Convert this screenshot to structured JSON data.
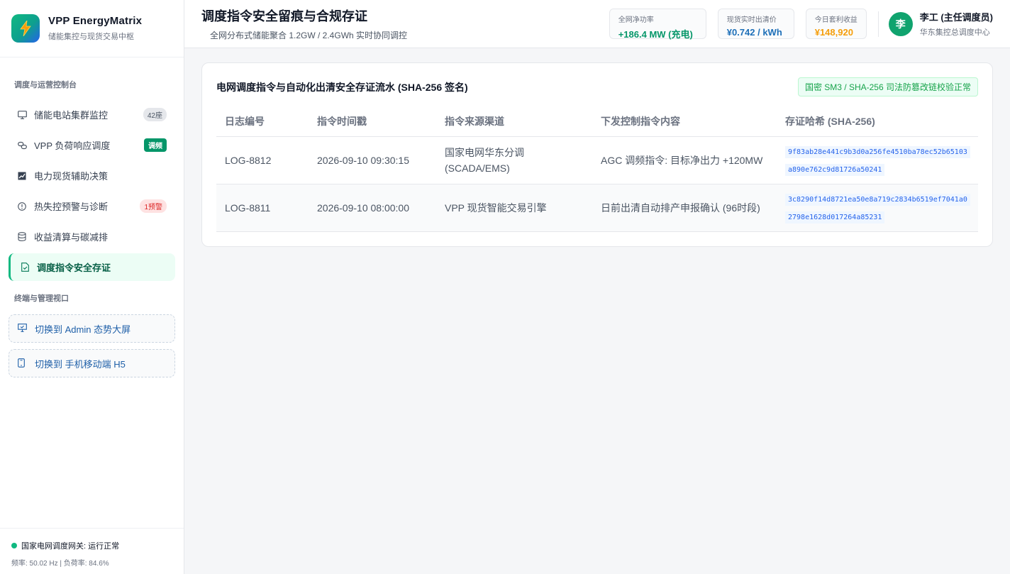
{
  "brand": {
    "title": "VPP EnergyMatrix",
    "subtitle": "储能集控与现货交易中枢"
  },
  "sidebar": {
    "section1_title": "调度与运营控制台",
    "items": [
      {
        "label": "储能电站集群监控",
        "icon": "monitor-icon",
        "badge": "42座"
      },
      {
        "label": "VPP 负荷响应调度",
        "icon": "link-icon",
        "badge": "调频"
      },
      {
        "label": "电力现货辅助决策",
        "icon": "chart-icon",
        "badge": ""
      },
      {
        "label": "热失控预警与诊断",
        "icon": "alert-circle-icon",
        "badge": "1预警"
      },
      {
        "label": "收益清算与碳减排",
        "icon": "database-icon",
        "badge": ""
      },
      {
        "label": "调度指令安全存证",
        "icon": "file-check-icon",
        "badge": ""
      }
    ],
    "section2_title": "终端与管理视口",
    "switch": [
      {
        "label": "切换到 Admin 态势大屏",
        "icon": "presentation-icon"
      },
      {
        "label": "切换到 手机移动端 H5",
        "icon": "mobile-icon"
      }
    ],
    "footer": {
      "status": "国家电网调度网关: 运行正常",
      "metrics": "频率: 50.02 Hz | 负荷率: 84.6%"
    }
  },
  "header": {
    "title": "调度指令安全留痕与合规存证",
    "subtitle": "全网分布式储能聚合 1.2GW / 2.4GWh 实时协同调控",
    "kpis": [
      {
        "label": "全网净功率",
        "value": "+186.4 MW (充电)"
      },
      {
        "label": "现货实时出清价",
        "value": "¥0.742 / kWh"
      },
      {
        "label": "今日套利收益",
        "value": "¥148,920"
      }
    ],
    "user": {
      "avatar": "李",
      "name": "李工 (主任调度员)",
      "org": "华东集控总调度中心"
    }
  },
  "card": {
    "title": "电网调度指令与自动化出清安全存证流水 (SHA-256 签名)",
    "verify": "国密 SM3 / SHA-256 司法防篡改链校验正常",
    "columns": [
      "日志编号",
      "指令时间戳",
      "指令来源渠道",
      "下发控制指令内容",
      "存证哈希 (SHA-256)"
    ],
    "rows": [
      {
        "id": "LOG-8812",
        "time": "2026-09-10 09:30:15",
        "source": "国家电网华东分调 (SCADA/EMS)",
        "command": "AGC 调频指令: 目标净出力 +120MW",
        "hash": "9f83ab28e441c9b3d0a256fe4510ba78ec52b65103a890e762c9d81726a50241"
      },
      {
        "id": "LOG-8811",
        "time": "2026-09-10 08:00:00",
        "source": "VPP 现货智能交易引擎",
        "command": "日前出清自动排产申报确认 (96时段)",
        "hash": "3c8290f14d8721ea50e8a719c2834b6519ef7041a02798e1628d017264a85231"
      }
    ]
  }
}
